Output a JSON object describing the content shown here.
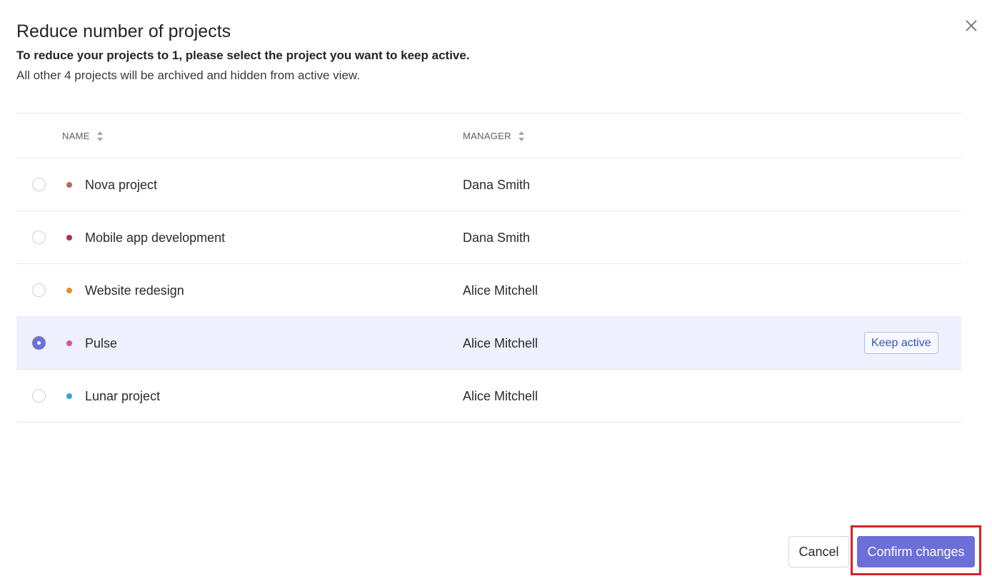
{
  "dialog": {
    "title": "Reduce number of projects",
    "subtitle": "To reduce your projects to 1, please select the project you want to keep active.",
    "description": "All other 4 projects will be archived and hidden from active view.",
    "close_icon": "close-icon"
  },
  "table": {
    "columns": {
      "name": "NAME",
      "manager": "MANAGER"
    },
    "sort_icon": "sort-icon",
    "rows": [
      {
        "name": "Nova project",
        "manager": "Dana Smith",
        "color": "#b86b5e",
        "selected": false
      },
      {
        "name": "Mobile app development",
        "manager": "Dana Smith",
        "color": "#a8324f",
        "selected": false
      },
      {
        "name": "Website redesign",
        "manager": "Alice Mitchell",
        "color": "#e88d2e",
        "selected": false
      },
      {
        "name": "Pulse",
        "manager": "Alice Mitchell",
        "color": "#d2559c",
        "selected": true,
        "badge": "Keep active"
      },
      {
        "name": "Lunar project",
        "manager": "Alice Mitchell",
        "color": "#3ba5c9",
        "selected": false
      }
    ]
  },
  "footer": {
    "cancel_label": "Cancel",
    "confirm_label": "Confirm changes"
  },
  "colors": {
    "accent": "#6c6fd8",
    "selected_row_bg": "#eef1fd",
    "highlight_border": "#d3232a"
  }
}
